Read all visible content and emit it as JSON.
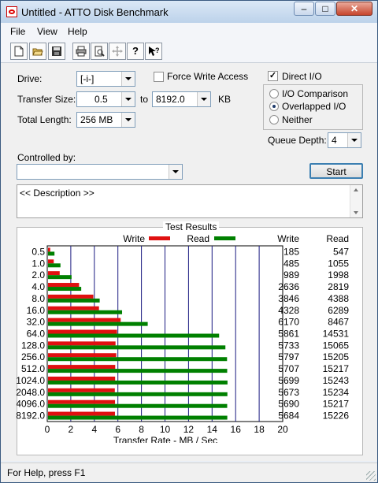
{
  "window": {
    "title": "Untitled - ATTO Disk Benchmark"
  },
  "caption_buttons": {
    "minimize": "–",
    "maximize": "□",
    "close": "✕"
  },
  "menu": [
    "File",
    "View",
    "Help"
  ],
  "toolbar": {
    "buttons": [
      {
        "name": "new",
        "icon": "new-document-icon"
      },
      {
        "name": "open",
        "icon": "open-folder-icon"
      },
      {
        "name": "save",
        "icon": "save-disk-icon"
      },
      {
        "name": "print",
        "icon": "printer-icon"
      },
      {
        "name": "print-preview",
        "icon": "print-preview-icon"
      },
      {
        "name": "move",
        "icon": "move-cross-icon",
        "disabled": true
      },
      {
        "name": "help",
        "icon": "question-icon",
        "glyph": "?"
      },
      {
        "name": "context-help",
        "icon": "context-help-icon"
      }
    ]
  },
  "form": {
    "drive_label": "Drive:",
    "drive_value": "[-i-]",
    "force_write_label": "Force Write Access",
    "force_write_checked": false,
    "direct_io_label": "Direct I/O",
    "direct_io_checked": true,
    "transfer_size_label": "Transfer Size:",
    "transfer_from": "0.5",
    "to_label": "to",
    "transfer_to": "8192.0",
    "kb_label": "KB",
    "total_length_label": "Total Length:",
    "total_length_value": "256 MB",
    "io_options": [
      {
        "label": "I/O Comparison",
        "selected": false
      },
      {
        "label": "Overlapped I/O",
        "selected": true
      },
      {
        "label": "Neither",
        "selected": false
      }
    ],
    "queue_depth_label": "Queue Depth:",
    "queue_depth_value": "4",
    "controlled_by_label": "Controlled by:",
    "controlled_by_value": "",
    "start_label": "Start",
    "description_text": "<< Description >>"
  },
  "results": {
    "group_title": "Test Results",
    "col_write": "Write",
    "col_read": "Read"
  },
  "chart_data": {
    "type": "bar",
    "orientation": "horizontal",
    "xlabel": "Transfer Rate - MB / Sec",
    "xlim": [
      0,
      20
    ],
    "xticks": [
      0,
      2,
      4,
      6,
      8,
      10,
      12,
      14,
      16,
      18,
      20
    ],
    "grid": true,
    "legend_placement": "top",
    "categories": [
      "0.5",
      "1.0",
      "2.0",
      "4.0",
      "8.0",
      "16.0",
      "32.0",
      "64.0",
      "128.0",
      "256.0",
      "512.0",
      "1024.0",
      "2048.0",
      "4096.0",
      "8192.0"
    ],
    "series": [
      {
        "name": "Write",
        "color": "#e01010",
        "values": [
          0.185,
          0.485,
          0.989,
          2.636,
          3.846,
          4.328,
          6.17,
          5.861,
          5.733,
          5.797,
          5.707,
          5.699,
          5.673,
          5.69,
          5.684
        ]
      },
      {
        "name": "Read",
        "color": "#008000",
        "values": [
          0.547,
          1.055,
          1.998,
          2.819,
          4.388,
          6.289,
          8.467,
          14.531,
          15.065,
          15.205,
          15.217,
          15.243,
          15.234,
          15.217,
          15.226
        ]
      }
    ],
    "write_labels": [
      "185",
      "485",
      "989",
      "2636",
      "3846",
      "4328",
      "6170",
      "5861",
      "5733",
      "5797",
      "5707",
      "5699",
      "5673",
      "5690",
      "5684"
    ],
    "read_labels": [
      "547",
      "1055",
      "1998",
      "2819",
      "4388",
      "6289",
      "8467",
      "14531",
      "15065",
      "15205",
      "15217",
      "15243",
      "15234",
      "15217",
      "15226"
    ]
  },
  "status": {
    "text": "For Help, press F1"
  }
}
